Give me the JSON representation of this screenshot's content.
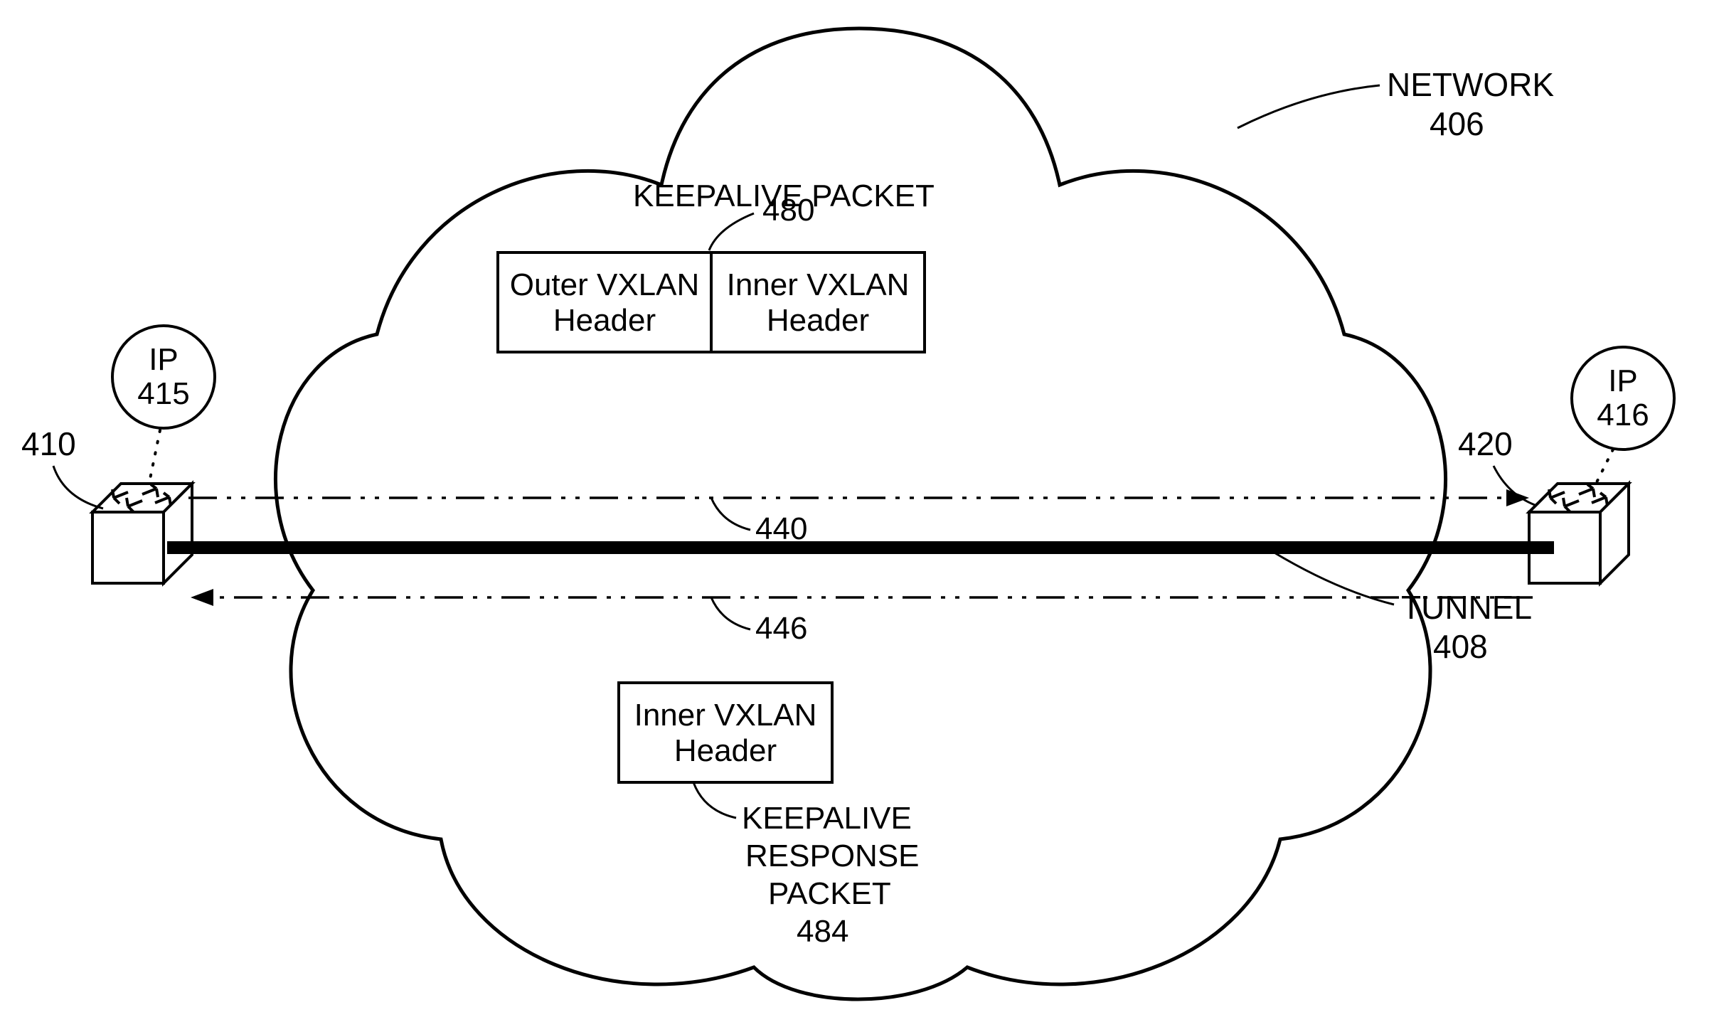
{
  "labels": {
    "network": "NETWORK",
    "network_ref": "406",
    "keepalive_packet": "KEEPALIVE PACKET",
    "keepalive_packet_ref": "480",
    "outer_vxlan_l1": "Outer VXLAN",
    "outer_vxlan_l2": "Header",
    "inner_vxlan_l1": "Inner VXLAN",
    "inner_vxlan_l2": "Header",
    "ip": "IP",
    "ip_left_ref": "415",
    "ip_right_ref": "416",
    "left_switch_ref": "410",
    "right_switch_ref": "420",
    "top_arrow_ref": "440",
    "bottom_arrow_ref": "446",
    "tunnel": "TUNNEL",
    "tunnel_ref": "408",
    "keepalive_resp_l1": "KEEPALIVE",
    "keepalive_resp_l2": "RESPONSE",
    "keepalive_resp_l3": "PACKET",
    "keepalive_resp_ref": "484"
  }
}
